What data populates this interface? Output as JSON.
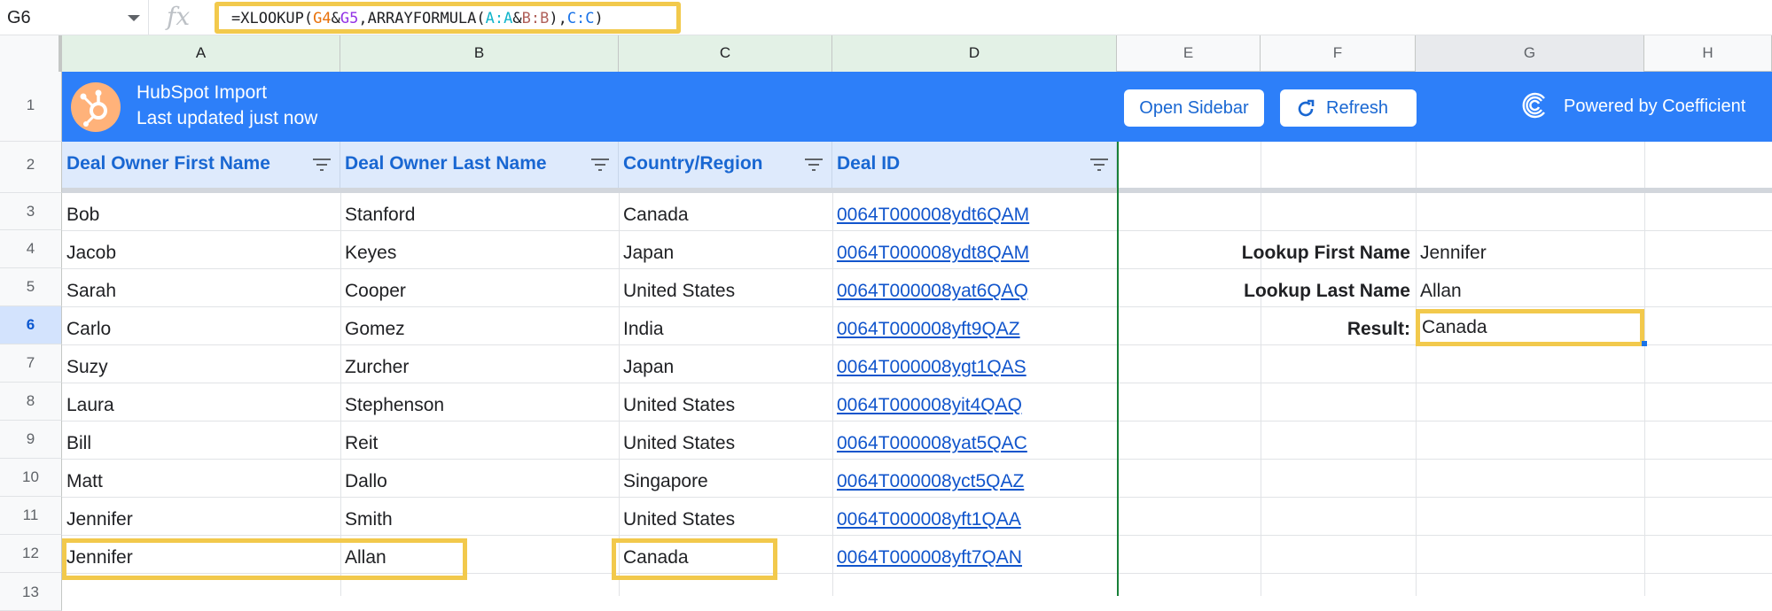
{
  "name_box": "G6",
  "formula": {
    "prefix": "=XLOOKUP(",
    "ref1": "G4",
    "amp1": "&",
    "ref2": "G5",
    "mid": ",ARRAYFORMULA(",
    "ref3": "A:A",
    "amp2": "&",
    "ref4": "B:B",
    "mid2": "),",
    "ref5": "C:C",
    "suffix": ")"
  },
  "columns": [
    "A",
    "B",
    "C",
    "D",
    "E",
    "F",
    "G",
    "H"
  ],
  "rows": [
    "1",
    "2",
    "3",
    "4",
    "5",
    "6",
    "7",
    "8",
    "9",
    "10",
    "11",
    "12",
    "13"
  ],
  "banner": {
    "title": "HubSpot Import",
    "subtitle": "Last updated just now",
    "open_sidebar": "Open Sidebar",
    "refresh": "Refresh",
    "powered_by": "Powered by Coefficient"
  },
  "headers": [
    "Deal Owner First Name",
    "Deal Owner Last Name",
    "Country/Region",
    "Deal ID"
  ],
  "data": [
    [
      "Bob",
      "Stanford",
      "Canada",
      "0064T000008ydt6QAM"
    ],
    [
      "Jacob",
      "Keyes",
      "Japan",
      "0064T000008ydt8QAM"
    ],
    [
      "Sarah",
      "Cooper",
      "United States",
      "0064T000008yat6QAQ"
    ],
    [
      "Carlo",
      "Gomez",
      "India",
      "0064T000008yft9QAZ"
    ],
    [
      "Suzy",
      "Zurcher",
      "Japan",
      "0064T000008ygt1QAS"
    ],
    [
      "Laura",
      "Stephenson",
      "United States",
      "0064T000008yit4QAQ"
    ],
    [
      "Bill",
      "Reit",
      "United States",
      "0064T000008yat5QAC"
    ],
    [
      "Matt",
      "Dallo",
      "Singapore",
      "0064T000008yct5QAZ"
    ],
    [
      "Jennifer",
      "Smith",
      "United States",
      "0064T000008yft1QAA"
    ],
    [
      "Jennifer",
      "Allan",
      "Canada",
      "0064T000008yft7QAN"
    ]
  ],
  "lookup": {
    "first_label": "Lookup First Name",
    "first_value": "Jennifer",
    "last_label": "Lookup Last Name",
    "last_value": "Allan",
    "result_label": "Result:",
    "result_value": "Canada"
  },
  "colors": {
    "banner": "#2d7ff9",
    "highlight": "#f2c94c",
    "header_fill": "#deeafc",
    "link": "#1155cc"
  }
}
